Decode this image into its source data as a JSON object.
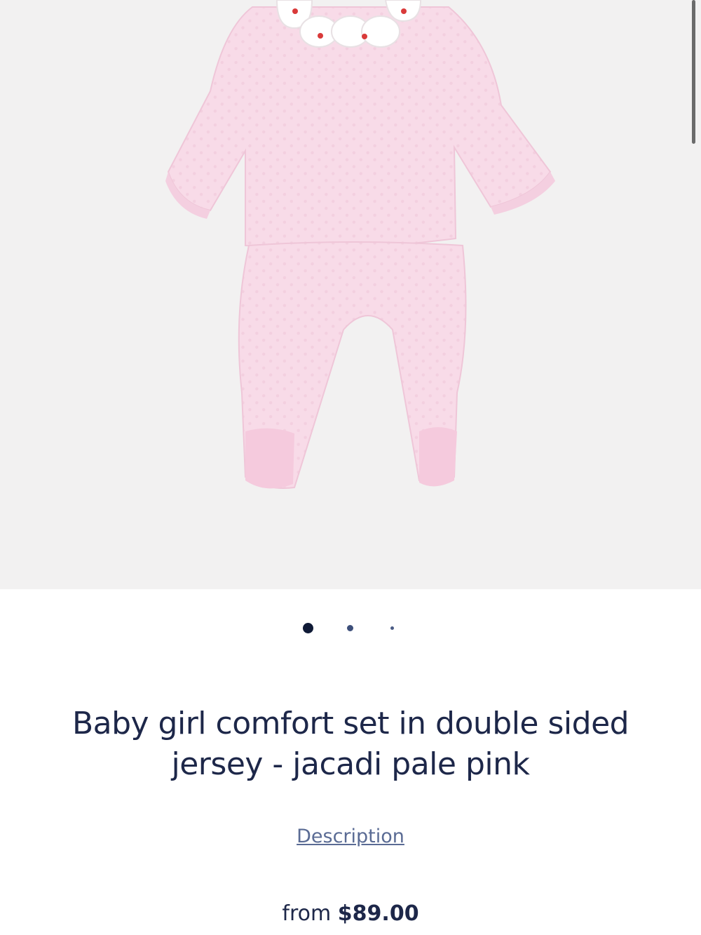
{
  "product": {
    "image_alt": "product-photo",
    "title": "Baby girl comfort set in double sided jersey - jacadi pale pink",
    "description_link": "Description",
    "price_prefix": "from",
    "price": "$89.00"
  },
  "carousel": {
    "slide_count": 3,
    "active_index": 0
  },
  "colors": {
    "text": "#1d2749",
    "link": "#5a6b94",
    "hero_bg": "#f2f1f1",
    "garment": "#f7d8e6"
  }
}
